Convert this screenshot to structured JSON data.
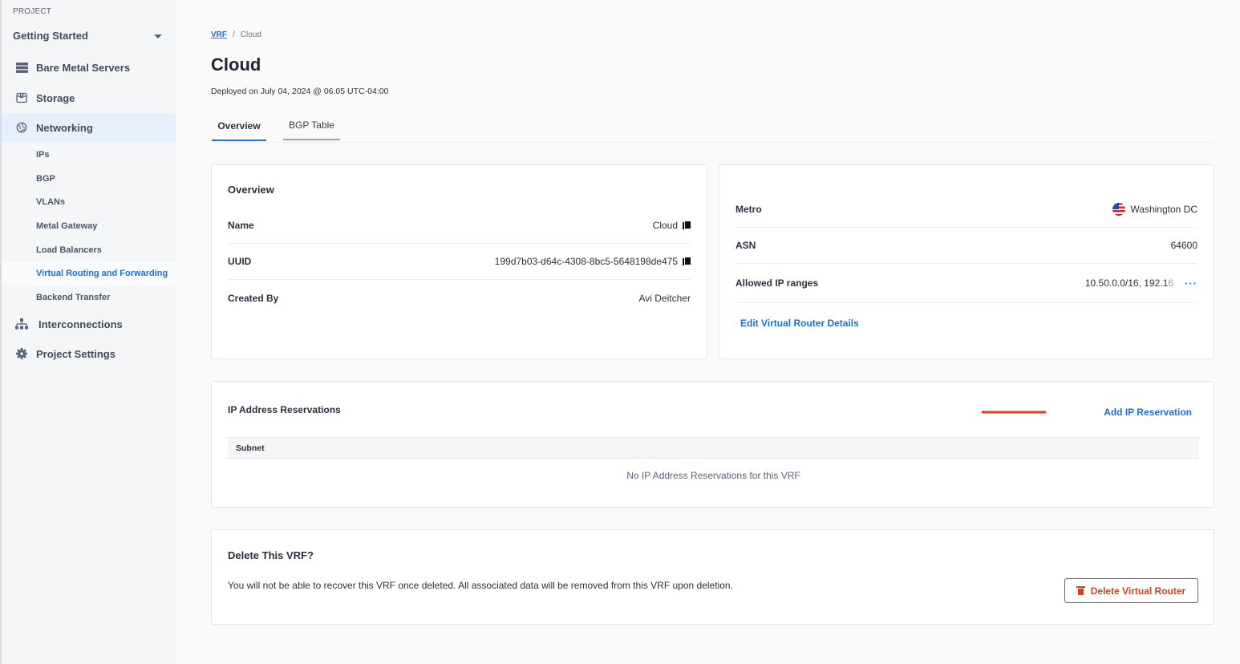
{
  "sidebar": {
    "project_label": "PROJECT",
    "project_name": "Getting Started",
    "items": [
      {
        "label": "Bare Metal Servers",
        "icon": "server-icon"
      },
      {
        "label": "Storage",
        "icon": "storage-box-icon"
      },
      {
        "label": "Networking",
        "icon": "globe-icon"
      },
      {
        "label": "Interconnections",
        "icon": "hierarchy-icon"
      },
      {
        "label": "Project Settings",
        "icon": "gear-icon"
      }
    ],
    "networking_sub": [
      {
        "label": "IPs"
      },
      {
        "label": "BGP"
      },
      {
        "label": "VLANs"
      },
      {
        "label": "Metal Gateway"
      },
      {
        "label": "Load Balancers"
      },
      {
        "label": "Virtual Routing and Forwarding"
      },
      {
        "label": "Backend Transfer"
      }
    ]
  },
  "breadcrumb": {
    "parent": "VRF",
    "separator": "/",
    "current": "Cloud"
  },
  "page": {
    "title": "Cloud",
    "deployed": "Deployed on July 04, 2024 @ 06.05 UTC-04:00"
  },
  "tabs": [
    {
      "label": "Overview"
    },
    {
      "label": "BGP Table"
    }
  ],
  "overview": {
    "title": "Overview",
    "rows": [
      {
        "key": "Name",
        "value": "Cloud"
      },
      {
        "key": "UUID",
        "value": "199d7b03-d64c-4308-8bc5-5648198de475"
      },
      {
        "key": "Created By",
        "value": "Avi Deitcher"
      }
    ]
  },
  "details": {
    "metro_label": "Metro",
    "metro_value": "Washington DC",
    "asn_label": "ASN",
    "asn_value": "64600",
    "ip_label": "Allowed IP ranges",
    "ip_value_main": "10.50.0.0/16, 192.1",
    "ip_value_faded": "6",
    "more": "···",
    "edit_link": "Edit Virtual Router Details"
  },
  "reservations": {
    "title": "IP Address Reservations",
    "add_link": "Add IP Reservation",
    "columns": [
      "Subnet"
    ],
    "empty": "No IP Address Reservations for this VRF",
    "arrow_color": "#f03a17"
  },
  "delete": {
    "title": "Delete This VRF?",
    "description": "You will not be able to recover this VRF once deleted. All associated data will be removed from this VRF upon deletion.",
    "button": "Delete Virtual Router"
  },
  "colors": {
    "accent": "#1a6fd8",
    "danger": "#d0421b"
  }
}
